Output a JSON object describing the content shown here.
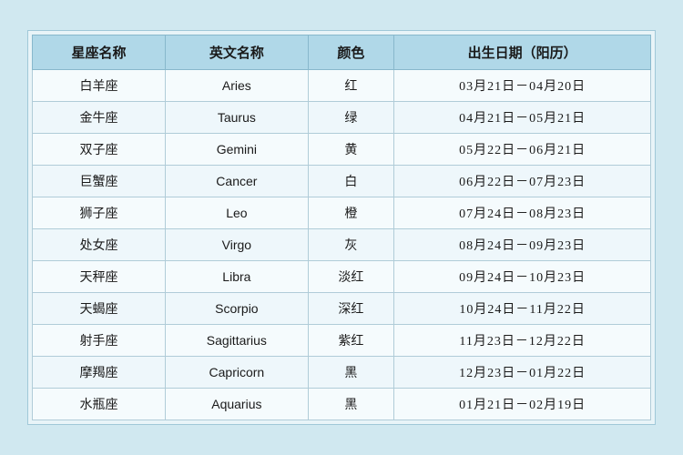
{
  "table": {
    "headers": [
      {
        "label": "星座名称",
        "key": "zh_name"
      },
      {
        "label": "英文名称",
        "key": "en_name"
      },
      {
        "label": "颜色",
        "key": "color"
      },
      {
        "label": "出生日期（阳历）",
        "key": "date_range"
      }
    ],
    "rows": [
      {
        "zh_name": "白羊座",
        "en_name": "Aries",
        "color": "红",
        "date_range": "03月21日－04月20日"
      },
      {
        "zh_name": "金牛座",
        "en_name": "Taurus",
        "color": "绿",
        "date_range": "04月21日－05月21日"
      },
      {
        "zh_name": "双子座",
        "en_name": "Gemini",
        "color": "黄",
        "date_range": "05月22日－06月21日"
      },
      {
        "zh_name": "巨蟹座",
        "en_name": "Cancer",
        "color": "白",
        "date_range": "06月22日－07月23日"
      },
      {
        "zh_name": "狮子座",
        "en_name": "Leo",
        "color": "橙",
        "date_range": "07月24日－08月23日"
      },
      {
        "zh_name": "处女座",
        "en_name": "Virgo",
        "color": "灰",
        "date_range": "08月24日－09月23日"
      },
      {
        "zh_name": "天秤座",
        "en_name": "Libra",
        "color": "淡红",
        "date_range": "09月24日－10月23日"
      },
      {
        "zh_name": "天蝎座",
        "en_name": "Scorpio",
        "color": "深红",
        "date_range": "10月24日－11月22日"
      },
      {
        "zh_name": "射手座",
        "en_name": "Sagittarius",
        "color": "紫红",
        "date_range": "11月23日－12月22日"
      },
      {
        "zh_name": "摩羯座",
        "en_name": "Capricorn",
        "color": "黑",
        "date_range": "12月23日－01月22日"
      },
      {
        "zh_name": "水瓶座",
        "en_name": "Aquarius",
        "color": "黑",
        "date_range": "01月21日－02月19日"
      }
    ]
  }
}
